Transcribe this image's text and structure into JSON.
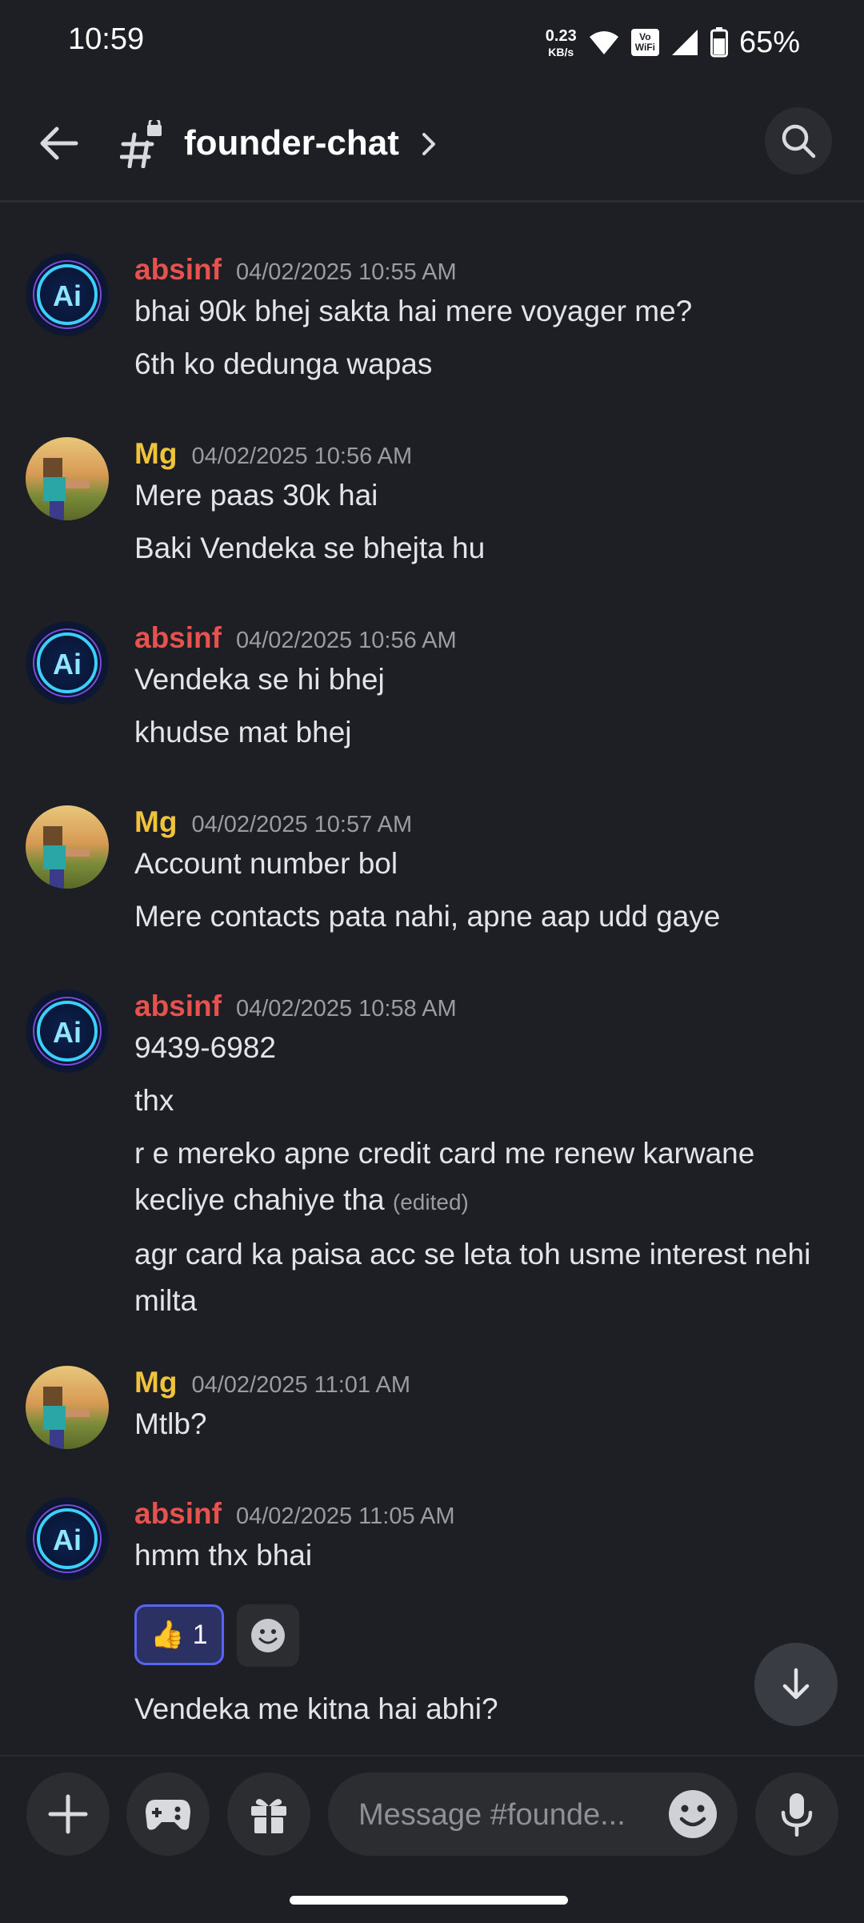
{
  "status_bar": {
    "time": "10:59",
    "net_speed_value": "0.23",
    "net_speed_unit": "KB/s",
    "vowifi_top": "Vo",
    "vowifi_bottom": "WiFi",
    "battery": "65%"
  },
  "header": {
    "channel": "founder-chat"
  },
  "messages": [
    {
      "author": "absinf",
      "timestamp": "04/02/2025 10:55 AM",
      "lines": [
        "bhai 90k bhej sakta hai mere voyager me?",
        "6th ko dedunga wapas"
      ]
    },
    {
      "author": "Mg",
      "timestamp": "04/02/2025 10:56 AM",
      "lines": [
        "Mere paas 30k hai",
        "Baki Vendeka se bhejta hu"
      ]
    },
    {
      "author": "absinf",
      "timestamp": "04/02/2025 10:56 AM",
      "lines": [
        "Vendeka se hi bhej",
        "khudse mat bhej"
      ]
    },
    {
      "author": "Mg",
      "timestamp": "04/02/2025 10:57 AM",
      "lines": [
        "Account number bol",
        "Mere contacts pata nahi, apne aap udd gaye"
      ]
    },
    {
      "author": "absinf",
      "timestamp": "04/02/2025 10:58 AM",
      "lines": [
        "9439-6982",
        "thx",
        "r e mereko apne credit card me renew karwane kecliye chahiye tha",
        "agr card ka paisa acc se leta toh usme interest nehi milta"
      ],
      "edited_label": "(edited)"
    },
    {
      "author": "Mg",
      "timestamp": "04/02/2025 11:01 AM",
      "lines": [
        "Mtlb?"
      ]
    },
    {
      "author": "absinf",
      "timestamp": "04/02/2025 11:05 AM",
      "lines": [
        "hmm thx bhai",
        "Vendeka me kitna hai abhi?"
      ],
      "reaction": {
        "emoji": "👍",
        "count": "1"
      }
    }
  ],
  "composer": {
    "placeholder": "Message #founde..."
  },
  "colors": {
    "background": "#1e1f24",
    "absinf_name": "#e6524d",
    "mg_name": "#f0c43a",
    "reaction_border": "#5865f2"
  },
  "icons": [
    "back-arrow-icon",
    "hashtag-lock-icon",
    "chevron-right-icon",
    "search-icon",
    "plus-icon",
    "gamepad-icon",
    "gift-icon",
    "emoji-icon",
    "microphone-icon",
    "arrow-down-icon",
    "wifi-icon",
    "signal-icon",
    "battery-icon"
  ]
}
